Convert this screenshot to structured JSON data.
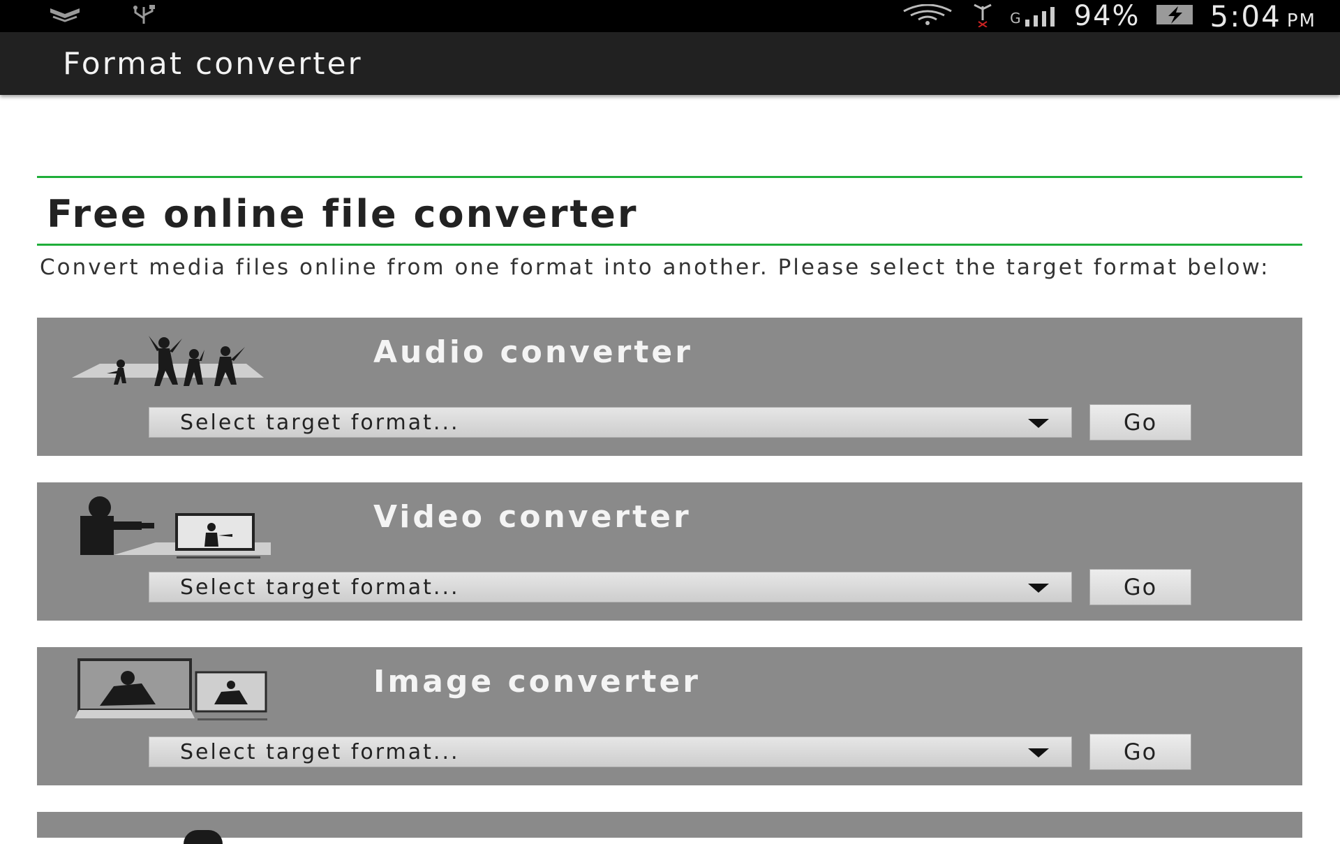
{
  "status_bar": {
    "left_icons": [
      "notification-drawer-icon",
      "usb-icon"
    ],
    "right_icons": [
      "wifi-icon",
      "antenna-icon",
      "signal-icon",
      "battery-charging-icon"
    ],
    "network_label": "G",
    "battery_text": "94%",
    "time": "5:04",
    "ampm": "PM"
  },
  "app_bar": {
    "title": "Format converter"
  },
  "page": {
    "heading": "Free online file converter",
    "intro": "Convert media files online from one format into another. Please select the target format below:"
  },
  "converters": [
    {
      "title": "Audio converter",
      "icon": "dancers-icon",
      "select_label": "Select target format...",
      "go_label": "Go"
    },
    {
      "title": "Video converter",
      "icon": "camera-screen-icon",
      "select_label": "Select target format...",
      "go_label": "Go"
    },
    {
      "title": "Image converter",
      "icon": "picture-frames-icon",
      "select_label": "Select target format...",
      "go_label": "Go"
    }
  ],
  "colors": {
    "status_bar_bg": "#000000",
    "app_bar_bg": "#212121",
    "accent_green": "#1fae3a",
    "panel_bg": "#8a8a8a"
  }
}
